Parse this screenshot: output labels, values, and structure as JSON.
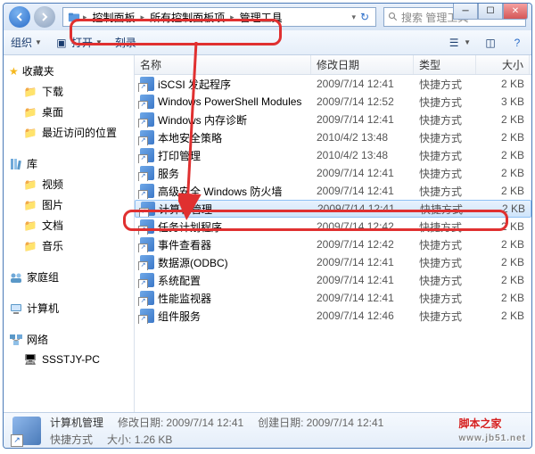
{
  "breadcrumb": {
    "a": "控制面板",
    "b": "所有控制面板项",
    "c": "管理工具"
  },
  "search": {
    "placeholder": "搜索 管理工具"
  },
  "toolbar": {
    "org": "组织",
    "open": "打开",
    "burn": "刻录"
  },
  "columns": {
    "name": "名称",
    "date": "修改日期",
    "type": "类型",
    "size": "大小"
  },
  "sidebar": {
    "fav": "收藏夹",
    "favs": [
      {
        "l": "下载"
      },
      {
        "l": "桌面"
      },
      {
        "l": "最近访问的位置"
      }
    ],
    "lib": "库",
    "libs": [
      {
        "l": "视频"
      },
      {
        "l": "图片"
      },
      {
        "l": "文档"
      },
      {
        "l": "音乐"
      }
    ],
    "home": "家庭组",
    "comp": "计算机",
    "net": "网络",
    "nets": [
      {
        "l": "SSSTJY-PC"
      }
    ]
  },
  "files": [
    {
      "n": "iSCSI 发起程序",
      "d": "2009/7/14 12:41",
      "t": "快捷方式",
      "s": "2 KB"
    },
    {
      "n": "Windows PowerShell Modules",
      "d": "2009/7/14 12:52",
      "t": "快捷方式",
      "s": "3 KB"
    },
    {
      "n": "Windows 内存诊断",
      "d": "2009/7/14 12:41",
      "t": "快捷方式",
      "s": "2 KB"
    },
    {
      "n": "本地安全策略",
      "d": "2010/4/2 13:48",
      "t": "快捷方式",
      "s": "2 KB"
    },
    {
      "n": "打印管理",
      "d": "2010/4/2 13:48",
      "t": "快捷方式",
      "s": "2 KB"
    },
    {
      "n": "服务",
      "d": "2009/7/14 12:41",
      "t": "快捷方式",
      "s": "2 KB"
    },
    {
      "n": "高级安全 Windows 防火墙",
      "d": "2009/7/14 12:41",
      "t": "快捷方式",
      "s": "2 KB"
    },
    {
      "n": "计算机管理",
      "d": "2009/7/14 12:41",
      "t": "快捷方式",
      "s": "2 KB",
      "sel": true
    },
    {
      "n": "任务计划程序",
      "d": "2009/7/14 12:42",
      "t": "快捷方式",
      "s": "2 KB"
    },
    {
      "n": "事件查看器",
      "d": "2009/7/14 12:42",
      "t": "快捷方式",
      "s": "2 KB"
    },
    {
      "n": "数据源(ODBC)",
      "d": "2009/7/14 12:41",
      "t": "快捷方式",
      "s": "2 KB"
    },
    {
      "n": "系统配置",
      "d": "2009/7/14 12:41",
      "t": "快捷方式",
      "s": "2 KB"
    },
    {
      "n": "性能监视器",
      "d": "2009/7/14 12:41",
      "t": "快捷方式",
      "s": "2 KB"
    },
    {
      "n": "组件服务",
      "d": "2009/7/14 12:46",
      "t": "快捷方式",
      "s": "2 KB"
    }
  ],
  "status": {
    "name": "计算机管理",
    "mod_l": "修改日期:",
    "mod_v": "2009/7/14 12:41",
    "cre_l": "创建日期:",
    "cre_v": "2009/7/14 12:41",
    "type": "快捷方式",
    "size_l": "大小:",
    "size_v": "1.26 KB"
  },
  "watermark": {
    "main": "脚本之家",
    "sub": "www.jb51.net"
  }
}
